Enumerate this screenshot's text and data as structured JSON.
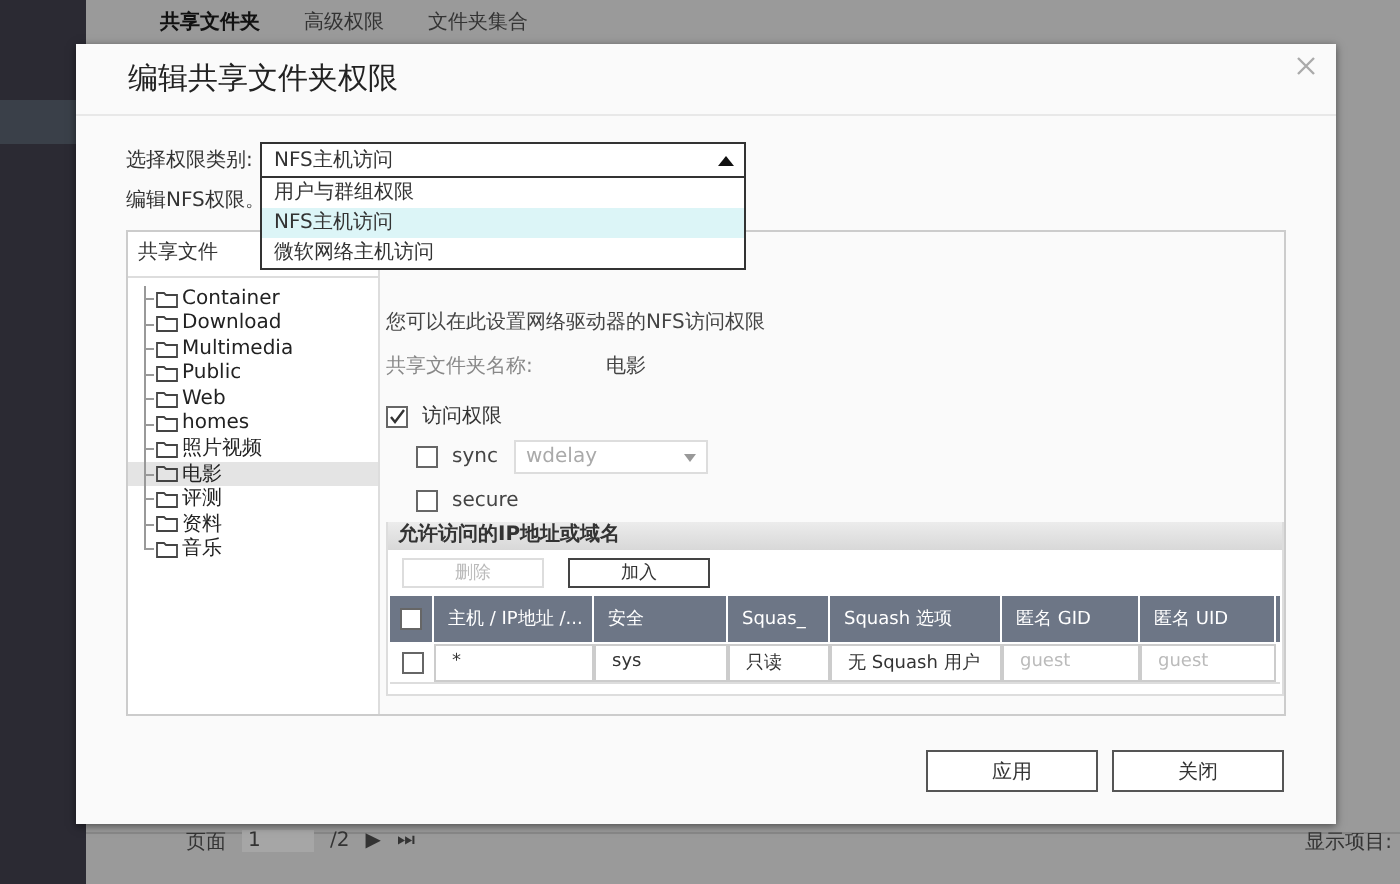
{
  "background": {
    "tabs": [
      {
        "label": "共享文件夹",
        "selected": true
      },
      {
        "label": "高级权限",
        "selected": false
      },
      {
        "label": "文件夹集合",
        "selected": false
      }
    ],
    "pager": {
      "label": "页面",
      "value": "1",
      "total": "/2",
      "next": "▶",
      "last": "⏭"
    },
    "display_label": "显示项目:"
  },
  "dialog": {
    "title": "编辑共享文件夹权限",
    "permission_type": {
      "label": "选择权限类别:",
      "value": "NFS主机访问",
      "expanded": true,
      "options": [
        {
          "label": "用户与群组权限",
          "selected": false
        },
        {
          "label": "NFS主机访问",
          "selected": true
        },
        {
          "label": "微软网络主机访问",
          "selected": false
        }
      ]
    },
    "hint": "编辑NFS权限。",
    "tree": {
      "header": "共享文件",
      "folders": [
        {
          "name": "Container",
          "selected": false
        },
        {
          "name": "Download",
          "selected": false
        },
        {
          "name": "Multimedia",
          "selected": false
        },
        {
          "name": "Public",
          "selected": false
        },
        {
          "name": "Web",
          "selected": false
        },
        {
          "name": "homes",
          "selected": false
        },
        {
          "name": "照片视频",
          "selected": false
        },
        {
          "name": "电影",
          "selected": true
        },
        {
          "name": "评测",
          "selected": false
        },
        {
          "name": "资料",
          "selected": false
        },
        {
          "name": "音乐",
          "selected": false
        }
      ]
    },
    "nfs": {
      "description": "您可以在此设置网络驱动器的NFS访问权限",
      "share_name_label": "共享文件夹名称:",
      "share_name": "电影",
      "access": {
        "label": "访问权限",
        "checked": true
      },
      "sync": {
        "label": "sync",
        "checked": false,
        "select_value": "wdelay",
        "disabled": true
      },
      "secure": {
        "label": "secure",
        "checked": false
      }
    },
    "hosts": {
      "title": "允许访问的IP地址或域名",
      "buttons": [
        {
          "label": "删除",
          "disabled": true
        },
        {
          "label": "加入",
          "disabled": false
        }
      ],
      "header_checked": false,
      "columns": [
        "主机 / IP地址 /...",
        "安全",
        "Squas_",
        "Squash 选项",
        "匿名 GID",
        "匿名 UID"
      ],
      "rows": [
        {
          "checked": false,
          "host": "*",
          "security": "sys",
          "squash": "只读",
          "squash_option": "无 Squash 用户",
          "gid_placeholder": "guest",
          "uid_placeholder": "guest"
        }
      ]
    },
    "buttons": [
      "应用",
      "关闭"
    ]
  }
}
